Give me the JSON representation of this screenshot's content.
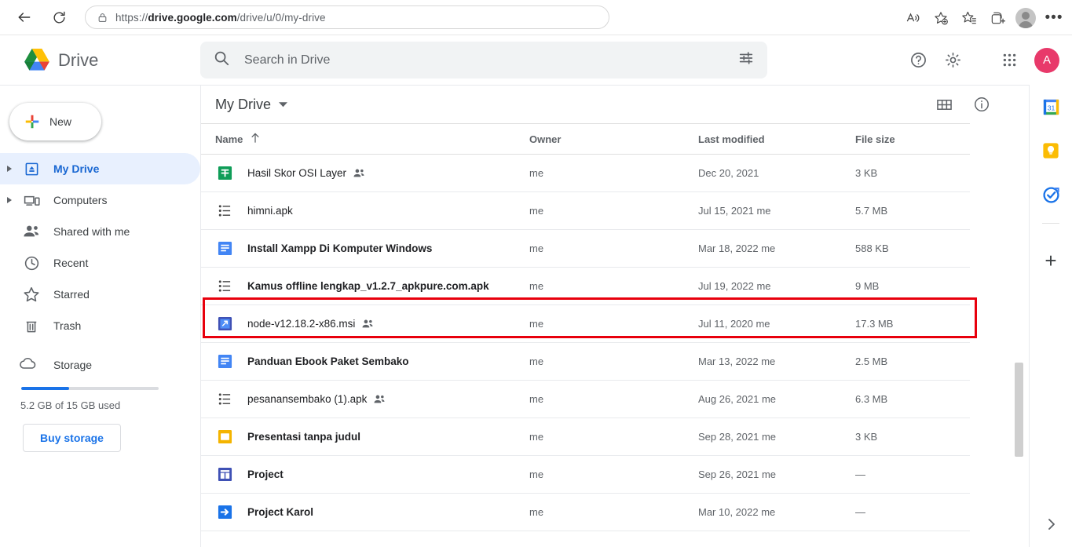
{
  "browser": {
    "back_label": "Back",
    "reload_label": "Refresh",
    "lock_label": "Site information",
    "url_prefix": "https://",
    "url_domain": "drive.google.com",
    "url_path": "/drive/u/0/my-drive",
    "read_aloud_label": "Read aloud",
    "add_favorite_label": "Add this page to favorites",
    "favorites_label": "Favorites",
    "collections_label": "Collections",
    "profile_label": "Profile",
    "more_label": "Settings and more"
  },
  "header": {
    "app_name": "Drive",
    "help_label": "Support",
    "settings_label": "Settings",
    "apps_label": "Google apps",
    "avatar_initial": "A"
  },
  "search": {
    "placeholder": "Search in Drive",
    "value": "",
    "icon": "search-icon",
    "options_label": "Search options"
  },
  "sidebar": {
    "new_label": "New",
    "items": [
      {
        "label": "My Drive",
        "icon": "my-drive-icon",
        "expandable": true,
        "active": true
      },
      {
        "label": "Computers",
        "icon": "computers-icon",
        "expandable": true,
        "active": false
      },
      {
        "label": "Shared with me",
        "icon": "people-icon",
        "expandable": false,
        "active": false
      },
      {
        "label": "Recent",
        "icon": "clock-icon",
        "expandable": false,
        "active": false
      },
      {
        "label": "Starred",
        "icon": "star-icon",
        "expandable": false,
        "active": false
      },
      {
        "label": "Trash",
        "icon": "trash-icon",
        "expandable": false,
        "active": false
      }
    ],
    "storage": {
      "label": "Storage",
      "icon": "cloud-icon",
      "used_text": "5.2 GB of 15 GB used",
      "used_percent": 35,
      "buy_label": "Buy storage",
      "accent_color": "#1a73e8"
    }
  },
  "main": {
    "breadcrumb": "My Drive",
    "grid_view_label": "Grid view",
    "details_label": "View details",
    "columns": {
      "name": "Name",
      "owner": "Owner",
      "modified": "Last modified",
      "size": "File size"
    },
    "sort": {
      "column": "Name",
      "direction": "asc",
      "icon": "arrow-up-icon"
    },
    "highlight_color": "#e8000d",
    "highlight_row_index": 3,
    "rows": [
      {
        "name": "Hasil Skor OSI Layer",
        "icon": "sheets-icon",
        "shared": true,
        "bold": false,
        "owner": "me",
        "modified": "Dec 20, 2021",
        "size": "3 KB"
      },
      {
        "name": "himni.apk",
        "icon": "apk-icon",
        "shared": false,
        "bold": false,
        "owner": "me",
        "modified": "Jul 15, 2021  me",
        "size": "5.7 MB"
      },
      {
        "name": "Install Xampp Di Komputer Windows",
        "icon": "docs-icon",
        "shared": false,
        "bold": true,
        "owner": "me",
        "modified": "Mar 18, 2022  me",
        "size": "588 KB"
      },
      {
        "name": "Kamus offline lengkap_v1.2.7_apkpure.com.apk",
        "icon": "apk-icon",
        "shared": false,
        "bold": true,
        "owner": "me",
        "modified": "Jul 19, 2022  me",
        "size": "9 MB"
      },
      {
        "name": "node-v12.18.2-x86.msi",
        "icon": "msi-icon",
        "shared": true,
        "bold": false,
        "owner": "me",
        "modified": "Jul 11, 2020  me",
        "size": "17.3 MB"
      },
      {
        "name": "Panduan Ebook Paket Sembako",
        "icon": "docs-icon",
        "shared": false,
        "bold": true,
        "owner": "me",
        "modified": "Mar 13, 2022  me",
        "size": "2.5 MB"
      },
      {
        "name": "pesanansembako (1).apk",
        "icon": "apk-icon",
        "shared": true,
        "bold": false,
        "owner": "me",
        "modified": "Aug 26, 2021  me",
        "size": "6.3 MB"
      },
      {
        "name": "Presentasi tanpa judul",
        "icon": "slides-icon",
        "shared": false,
        "bold": true,
        "owner": "me",
        "modified": "Sep 28, 2021  me",
        "size": "3 KB"
      },
      {
        "name": "Project",
        "icon": "sites-icon",
        "shared": false,
        "bold": true,
        "owner": "me",
        "modified": "Sep 26, 2021  me",
        "size": "—"
      },
      {
        "name": "Project Karol",
        "icon": "shortcut-icon",
        "shared": false,
        "bold": true,
        "owner": "me",
        "modified": "Mar 10, 2022  me",
        "size": "—"
      }
    ]
  },
  "rail": {
    "items": [
      {
        "label": "Calendar",
        "icon": "calendar-icon",
        "badge": "31"
      },
      {
        "label": "Keep",
        "icon": "keep-icon",
        "badge": ""
      },
      {
        "label": "Tasks",
        "icon": "tasks-icon",
        "badge": ""
      }
    ],
    "add_label": "Get add-ons",
    "expand_label": "Show side panel"
  }
}
